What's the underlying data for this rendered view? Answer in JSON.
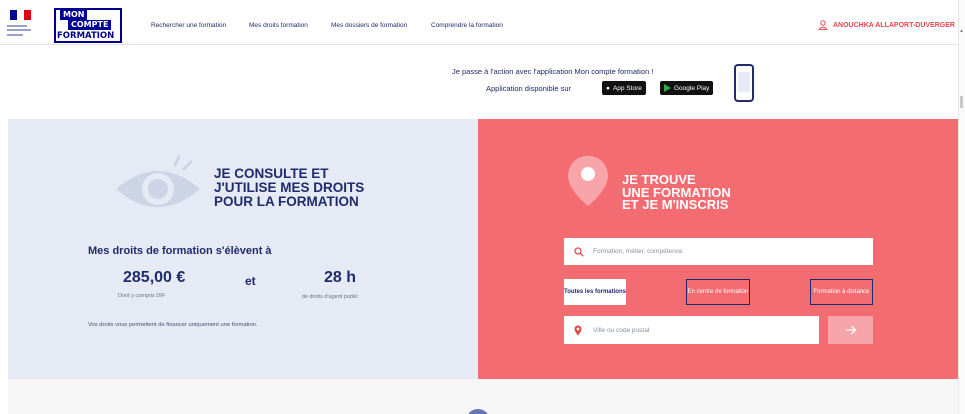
{
  "header": {
    "logo": {
      "line1": "MON",
      "line2": "COMPTE",
      "line3": "FORMATION"
    },
    "nav": [
      {
        "label": "Rechercher une formation"
      },
      {
        "label": "Mes droits formation"
      },
      {
        "label": "Mes dossiers de formation"
      },
      {
        "label": "Comprendre la formation"
      }
    ],
    "user_name": "ANOUCHKA ALLAPORT-DUVERGER"
  },
  "promo": {
    "line1": "Je passe à l'action avec l'application Mon compte formation !",
    "line2": "Application disponible sur",
    "app_store": "App Store",
    "google_play": "Google Play"
  },
  "left_panel": {
    "title_lines": [
      "JE CONSULTE ET",
      "J'UTILISE MES DROITS",
      "POUR LA FORMATION"
    ],
    "rights_label": "Mes droits de formation s'élèvent à",
    "amount": "285,00 €",
    "amount_sub": "Dont y compris DIF",
    "connector": "et",
    "hours": "28 h",
    "hours_sub": "de droits d'agent public",
    "note": "Vos droits vous permettent de financer uniquement une formation."
  },
  "right_panel": {
    "title_lines": [
      "JE TROUVE",
      "UNE FORMATION",
      "ET JE M'INSCRIS"
    ],
    "search_placeholder": "Formation, métier, compétence",
    "tabs": [
      {
        "label": "Toutes les formations"
      },
      {
        "label": "En centre de formation"
      },
      {
        "label": "Formation à distance"
      }
    ],
    "city_placeholder": "Ville ou code postal"
  },
  "colors": {
    "brand_blue": "#000091",
    "navy": "#1f2b6c",
    "coral": "#f36c71",
    "light_panel": "#e6eaf4",
    "accent_red": "#e2484f"
  }
}
